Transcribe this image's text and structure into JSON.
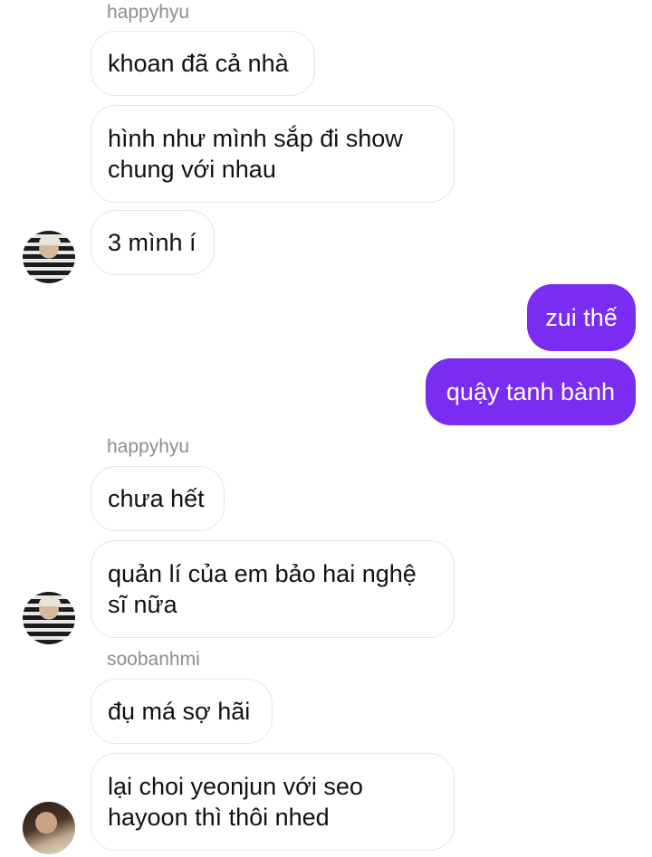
{
  "messages": [
    {
      "sender": "happyhyu",
      "texts": [
        "khoan đã cả nhà",
        "hình như mình sắp đi show chung với nhau",
        "3 mình í"
      ]
    },
    {
      "outgoing": [
        "zui thế",
        "quậy tanh bành"
      ]
    },
    {
      "sender": "happyhyu",
      "texts": [
        "chưa hết",
        "quản lí của em bảo hai nghệ sĩ nữa"
      ]
    },
    {
      "sender": "soobanhmi",
      "texts": [
        "đụ má sợ hãi",
        "lại choi yeonjun với seo hayoon thì thôi nhed"
      ]
    }
  ],
  "colors": {
    "outgoing_bubble": "#7a2cf3",
    "incoming_border": "#e6e6e6",
    "sender_name": "#8e8e8e"
  }
}
